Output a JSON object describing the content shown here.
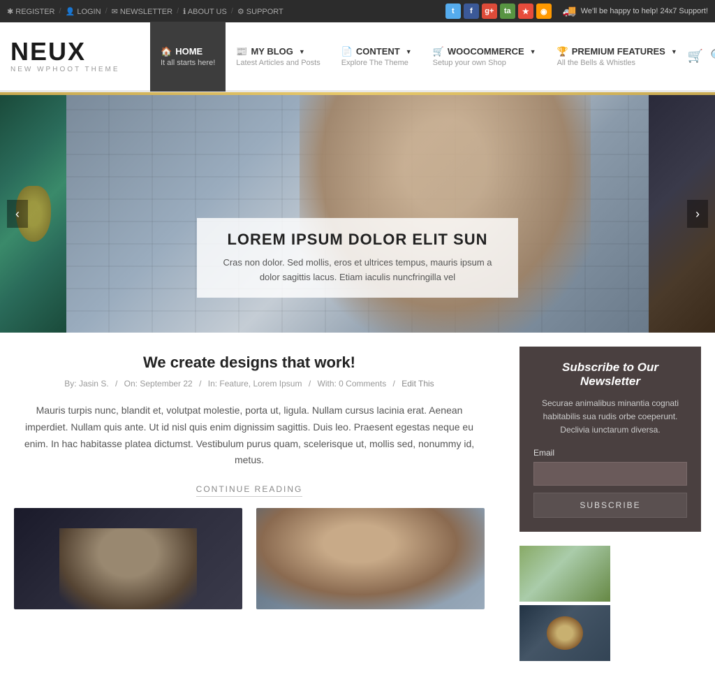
{
  "topbar": {
    "links": [
      {
        "label": "REGISTER",
        "icon": "✱"
      },
      {
        "label": "LOGIN",
        "icon": "👤"
      },
      {
        "label": "NEWSLETTER",
        "icon": "✉"
      },
      {
        "label": "ABOUT US",
        "icon": "ℹ"
      },
      {
        "label": "SUPPORT",
        "icon": "⚙"
      }
    ],
    "social": [
      {
        "name": "twitter",
        "icon": "t",
        "class": "si-twitter"
      },
      {
        "name": "facebook",
        "icon": "f",
        "class": "si-facebook"
      },
      {
        "name": "google",
        "icon": "g+",
        "class": "si-google"
      },
      {
        "name": "tripadvisor",
        "icon": "ta",
        "class": "si-tripadvisor"
      },
      {
        "name": "star",
        "icon": "★",
        "class": "si-star"
      },
      {
        "name": "rss",
        "icon": "◉",
        "class": "si-rss"
      }
    ],
    "support_text": "We'll be happy to help! 24x7 Support!"
  },
  "header": {
    "logo": "NEUX",
    "tagline": "NEW WPHOOT THEME",
    "nav": [
      {
        "label": "HOME",
        "sublabel": "It all starts here!",
        "icon": "🏠",
        "active": true,
        "has_arrow": false
      },
      {
        "label": "MY BLOG",
        "sublabel": "Latest Articles and Posts",
        "icon": "📰",
        "active": false,
        "has_arrow": true
      },
      {
        "label": "CONTENT",
        "sublabel": "Explore The Theme",
        "icon": "📄",
        "active": false,
        "has_arrow": true
      },
      {
        "label": "WOOCOMMERCE",
        "sublabel": "Setup your own Shop",
        "icon": "🛒",
        "active": false,
        "has_arrow": true
      },
      {
        "label": "PREMIUM FEATURES",
        "sublabel": "All the Bells & Whistles",
        "icon": "🏆",
        "active": false,
        "has_arrow": true
      }
    ]
  },
  "slider": {
    "caption_title": "LOREM IPSUM DOLOR ELIT SUN",
    "caption_text": "Cras non dolor. Sed mollis, eros et ultrices tempus, mauris ipsum a dolor sagittis lacus. Etiam iaculis nuncfringilla vel"
  },
  "article": {
    "title": "We create designs that work!",
    "meta_by": "By: Jasin S.",
    "meta_on": "On: September 22",
    "meta_in": "In: Feature, Lorem Ipsum",
    "meta_with": "With: 0 Comments",
    "meta_edit": "Edit This",
    "body": "Mauris turpis nunc, blandit et, volutpat molestie, porta ut, ligula. Nullam cursus lacinia erat. Aenean imperdiet. Nullam quis ante. Ut id nisl quis enim dignissim sagittis. Duis leo. Praesent egestas neque eu enim. In hac habitasse platea dictumst. Vestibulum purus quam, scelerisque ut, mollis sed, nonummy id, metus.",
    "continue_label": "CONTINUE READING"
  },
  "sidebar": {
    "newsletter_title": "Subscribe to Our Newsletter",
    "newsletter_desc": "Securae animalibus minantia cognati habitabilis sua rudis orbe coeperunt. Declivia iunctarum diversa.",
    "email_label": "Email",
    "email_placeholder": "",
    "subscribe_label": "SUBSCRIBE"
  }
}
